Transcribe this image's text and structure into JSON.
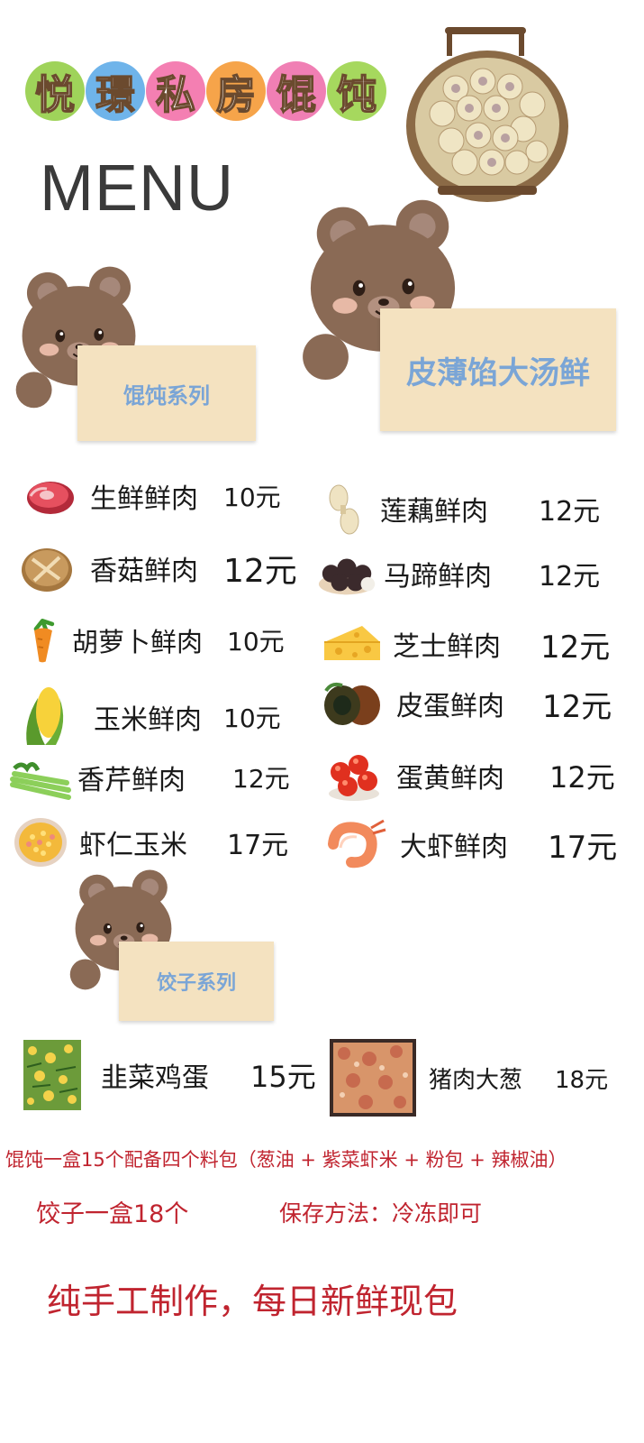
{
  "header": {
    "title_chars": [
      "悦",
      "璟",
      "私",
      "房",
      "馄",
      "饨"
    ],
    "title_colors": [
      "#9fd35a",
      "#6fb4ea",
      "#f47fb2",
      "#f6a44a",
      "#f07fb4",
      "#a6d85e"
    ],
    "menu_word": "MENU"
  },
  "sections": {
    "wonton_series": "馄饨系列",
    "tagline": "皮薄馅大汤鲜",
    "dumpling_series": "饺子系列"
  },
  "wonton_left": [
    {
      "name": "生鲜鲜肉",
      "price": "10元",
      "icon": "raw-meat-icon"
    },
    {
      "name": "香菇鲜肉",
      "price": "12元",
      "icon": "mushroom-icon"
    },
    {
      "name": "胡萝卜鲜肉",
      "price": "10元",
      "icon": "carrot-icon"
    },
    {
      "name": "玉米鲜肉",
      "price": "10元",
      "icon": "corn-icon"
    },
    {
      "name": "香芹鲜肉",
      "price": "12元",
      "icon": "celery-icon"
    },
    {
      "name": "虾仁玉米",
      "price": "17元",
      "icon": "shrimp-corn-icon"
    }
  ],
  "wonton_right": [
    {
      "name": "莲藕鲜肉",
      "price": "12元",
      "icon": "lotus-root-icon"
    },
    {
      "name": "马蹄鲜肉",
      "price": "12元",
      "icon": "water-chestnut-icon"
    },
    {
      "name": "芝士鲜肉",
      "price": "12元",
      "icon": "cheese-icon"
    },
    {
      "name": "皮蛋鲜肉",
      "price": "12元",
      "icon": "century-egg-icon"
    },
    {
      "name": "蛋黄鲜肉",
      "price": "12元",
      "icon": "egg-yolk-icon"
    },
    {
      "name": "大虾鲜肉",
      "price": "17元",
      "icon": "shrimp-icon"
    }
  ],
  "dumplings": [
    {
      "name": "韭菜鸡蛋",
      "price": "15元",
      "icon": "chive-egg-filling-icon"
    },
    {
      "name": "猪肉大葱",
      "price": "18元",
      "icon": "pork-scallion-filling-icon"
    }
  ],
  "notes": {
    "wonton_box": "馄饨一盒15个配备四个料包（葱油 + 紫菜虾米 + 粉包 + 辣椒油）",
    "dumpling_box": "饺子一盒18个",
    "storage": "保存方法：冷冻即可",
    "slogan": "纯手工制作，每日新鲜现包"
  },
  "colors": {
    "note_red": "#c0242f",
    "card_bg": "#f4e2c0",
    "card_text": "#7aa5d6",
    "bear_brown": "#8a6a55"
  }
}
